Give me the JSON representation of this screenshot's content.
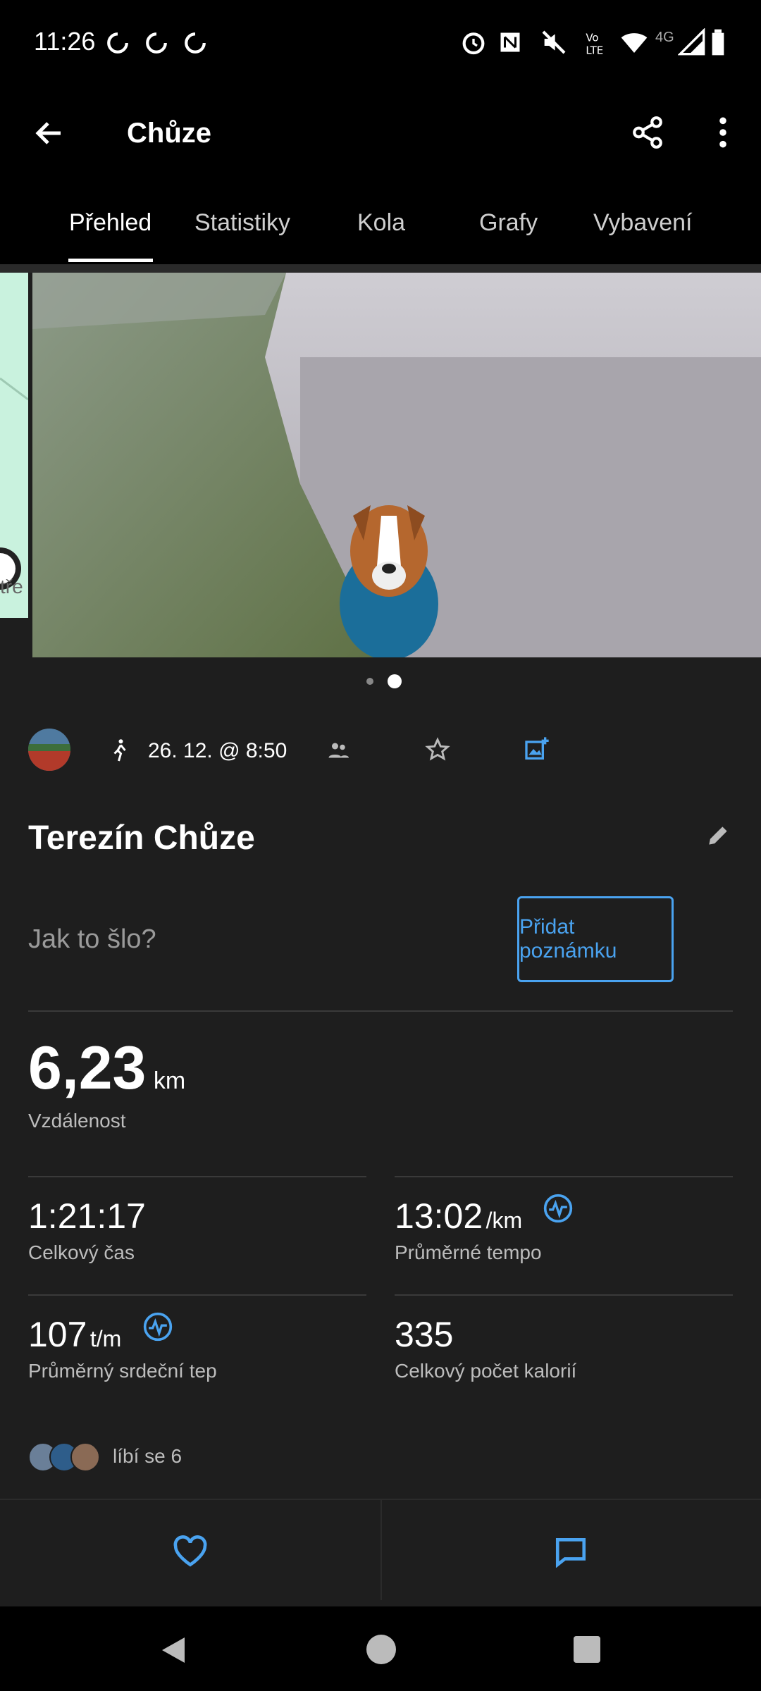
{
  "status_bar": {
    "time": "11:26",
    "icons": [
      "sync-icon",
      "sync-icon",
      "sync-icon",
      "alarm-icon",
      "nfc-icon",
      "mute-icon",
      "volte-icon",
      "wifi-icon",
      "4g-signal-icon",
      "battery-icon"
    ],
    "network": "4G"
  },
  "app_bar": {
    "title": "Chůze",
    "back_icon": "arrow-left-icon",
    "share_icon": "share-icon",
    "menu_icon": "more-vert-icon"
  },
  "tabs": [
    {
      "label": "Přehled",
      "active": true
    },
    {
      "label": "Statistiky",
      "active": false
    },
    {
      "label": "Kola",
      "active": false
    },
    {
      "label": "Grafy",
      "active": false
    },
    {
      "label": "Vybavení",
      "active": false
    }
  ],
  "carousel": {
    "slides": 2,
    "active_index": 1,
    "map_label_fragment": "tře"
  },
  "activity_meta": {
    "date": "26. 12. @ 8:50",
    "icons": [
      "walk-icon",
      "people-icon",
      "star-icon",
      "add-photo-icon"
    ]
  },
  "activity": {
    "name": "Terezín Chůze",
    "note_prompt": "Jak to šlo?",
    "add_note_label": "Přidat poznámku"
  },
  "stats": {
    "distance_value": "6,23",
    "distance_unit": "km",
    "distance_label": "Vzdálenost",
    "total_time_value": "1:21:17",
    "total_time_label": "Celkový čas",
    "pace_value": "13:02",
    "pace_unit": "/km",
    "pace_label": "Průměrné tempo",
    "hr_value": "107",
    "hr_unit": "t/m",
    "hr_label": "Průměrný srdeční tep",
    "calories_value": "335",
    "calories_label": "Celkový počet kalorií"
  },
  "social": {
    "likes_text": "líbí se 6"
  },
  "colors": {
    "accent": "#4aa3f0",
    "background": "#1e1e1e"
  }
}
